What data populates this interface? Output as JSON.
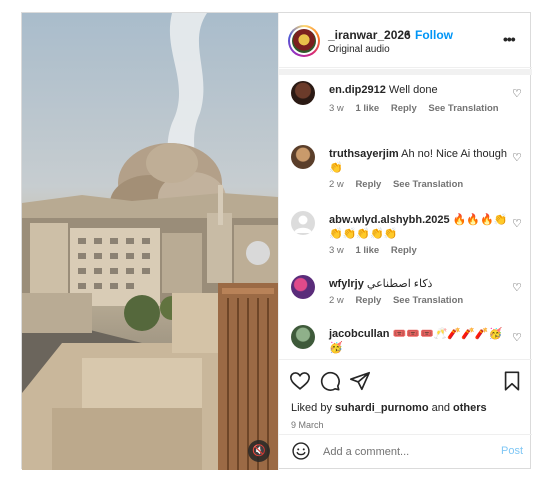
{
  "post": {
    "username": "_iranwar_2026",
    "separator": "•",
    "follow_label": "Follow",
    "audio": "Original audio",
    "more_glyph": "•••"
  },
  "comments": [
    {
      "user": "en.dip2912",
      "text": "Well done",
      "time": "3 w",
      "likes": "1 like",
      "reply": "Reply",
      "translate": "See Translation"
    },
    {
      "user": "truthsayerjim",
      "text": "Ah no! Nice Ai though 👏",
      "time": "2 w",
      "reply": "Reply",
      "translate": "See Translation"
    },
    {
      "user": "abw.wlyd.alshybh.2025",
      "text": "🔥🔥🔥👏👏👏👏👏👏",
      "time": "3 w",
      "likes": "1 like",
      "reply": "Reply"
    },
    {
      "user": "wfylrjy",
      "text": "ذكاء اصطناعي",
      "time": "2 w",
      "reply": "Reply",
      "translate": "See Translation"
    },
    {
      "user": "jacobcullan",
      "text": "🎟️🎟️🎟️🥂🧨🧨🧨🥳🥳",
      "time": ""
    }
  ],
  "likes": {
    "prefix": "Liked by",
    "user": "suhardi_purnomo",
    "and": "and",
    "others": "others"
  },
  "date": "9 March",
  "add_comment": {
    "placeholder": "Add a comment...",
    "post_label": "Post"
  },
  "colors": {
    "accent": "#0095f6",
    "post_disabled": "#7fc7f5",
    "muted": "#737373"
  },
  "icons": [
    "heart-icon",
    "comment-icon",
    "share-icon",
    "bookmark-icon",
    "emoji-icon",
    "mute-icon",
    "more-icon"
  ]
}
